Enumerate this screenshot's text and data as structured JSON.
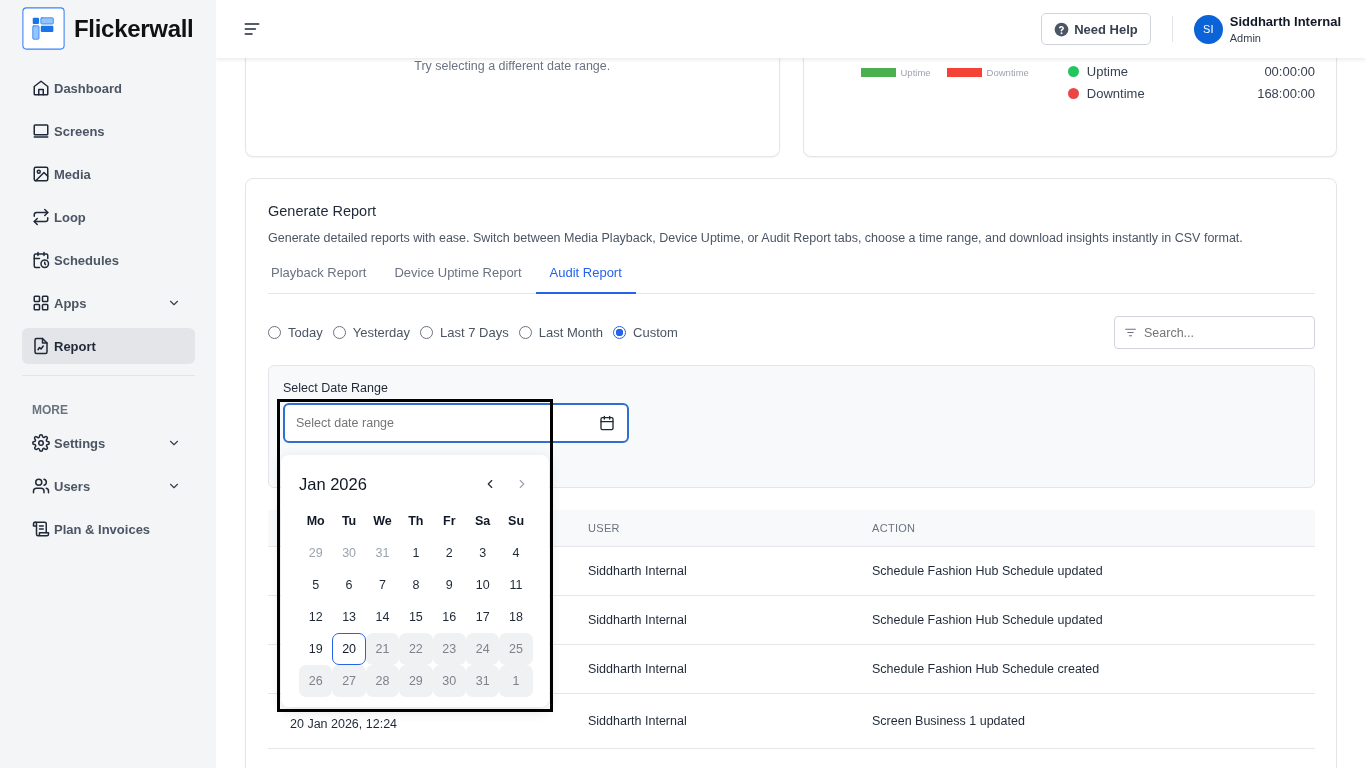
{
  "brand": {
    "name": "Flickerwall"
  },
  "sidebar": {
    "items": [
      {
        "label": "Dashboard",
        "kind": "link",
        "selected": false
      },
      {
        "label": "Screens",
        "kind": "link",
        "selected": false
      },
      {
        "label": "Media",
        "kind": "link",
        "selected": false
      },
      {
        "label": "Loop",
        "kind": "link",
        "selected": false
      },
      {
        "label": "Schedules",
        "kind": "link",
        "selected": false
      },
      {
        "label": "Apps",
        "kind": "group",
        "selected": false
      },
      {
        "label": "Report",
        "kind": "link",
        "selected": true
      }
    ],
    "section_label": "MORE",
    "more_items": [
      {
        "label": "Settings",
        "kind": "group",
        "selected": false
      },
      {
        "label": "Users",
        "kind": "group",
        "selected": false
      },
      {
        "label": "Plan & Invoices",
        "kind": "link",
        "selected": false
      }
    ]
  },
  "header": {
    "help_button": "Need Help",
    "user": {
      "initials": "SI",
      "name": "Siddharth Internal",
      "role": "Admin"
    }
  },
  "empty_card": {
    "message": "Try selecting a different date range."
  },
  "uptime_card": {
    "legend": [
      {
        "label": "Uptime",
        "color": "#4caf50"
      },
      {
        "label": "Downtime",
        "color": "#f44336"
      }
    ],
    "stats": [
      {
        "label": "Uptime",
        "value": "00:00:00",
        "color": "#22c55e"
      },
      {
        "label": "Downtime",
        "value": "168:00:00",
        "color": "#ef4444"
      }
    ]
  },
  "report": {
    "title": "Generate Report",
    "description": "Generate detailed reports with ease. Switch between Media Playback, Device Uptime, or Audit Report tabs, choose a time range, and download insights instantly in CSV format.",
    "tabs": [
      {
        "label": "Playback Report",
        "selected": false
      },
      {
        "label": "Device Uptime Report",
        "selected": false
      },
      {
        "label": "Audit Report",
        "selected": true
      }
    ],
    "ranges": [
      {
        "label": "Today",
        "selected": false
      },
      {
        "label": "Yesterday",
        "selected": false
      },
      {
        "label": "Last 7 Days",
        "selected": false
      },
      {
        "label": "Last Month",
        "selected": false
      },
      {
        "label": "Custom",
        "selected": true
      }
    ],
    "search": {
      "placeholder": "Search..."
    },
    "date_range": {
      "label": "Select Date Range",
      "placeholder": "Select date range"
    },
    "calendar": {
      "month": "Jan 2026",
      "next_disabled": true,
      "weekdays": [
        "Mo",
        "Tu",
        "We",
        "Th",
        "Fr",
        "Sa",
        "Su"
      ],
      "days": [
        {
          "label": "29",
          "outside": true,
          "disabled": false,
          "selected": false
        },
        {
          "label": "30",
          "outside": true,
          "disabled": false,
          "selected": false
        },
        {
          "label": "31",
          "outside": true,
          "disabled": false,
          "selected": false
        },
        {
          "label": "1",
          "outside": false,
          "disabled": false,
          "selected": false
        },
        {
          "label": "2",
          "outside": false,
          "disabled": false,
          "selected": false
        },
        {
          "label": "3",
          "outside": false,
          "disabled": false,
          "selected": false
        },
        {
          "label": "4",
          "outside": false,
          "disabled": false,
          "selected": false
        },
        {
          "label": "5",
          "outside": false,
          "disabled": false,
          "selected": false
        },
        {
          "label": "6",
          "outside": false,
          "disabled": false,
          "selected": false
        },
        {
          "label": "7",
          "outside": false,
          "disabled": false,
          "selected": false
        },
        {
          "label": "8",
          "outside": false,
          "disabled": false,
          "selected": false
        },
        {
          "label": "9",
          "outside": false,
          "disabled": false,
          "selected": false
        },
        {
          "label": "10",
          "outside": false,
          "disabled": false,
          "selected": false
        },
        {
          "label": "11",
          "outside": false,
          "disabled": false,
          "selected": false
        },
        {
          "label": "12",
          "outside": false,
          "disabled": false,
          "selected": false
        },
        {
          "label": "13",
          "outside": false,
          "disabled": false,
          "selected": false
        },
        {
          "label": "14",
          "outside": false,
          "disabled": false,
          "selected": false
        },
        {
          "label": "15",
          "outside": false,
          "disabled": false,
          "selected": false
        },
        {
          "label": "16",
          "outside": false,
          "disabled": false,
          "selected": false
        },
        {
          "label": "17",
          "outside": false,
          "disabled": false,
          "selected": false
        },
        {
          "label": "18",
          "outside": false,
          "disabled": false,
          "selected": false
        },
        {
          "label": "19",
          "outside": false,
          "disabled": false,
          "selected": false
        },
        {
          "label": "20",
          "outside": false,
          "disabled": false,
          "selected": true
        },
        {
          "label": "21",
          "outside": false,
          "disabled": true,
          "selected": false
        },
        {
          "label": "22",
          "outside": false,
          "disabled": true,
          "selected": false
        },
        {
          "label": "23",
          "outside": false,
          "disabled": true,
          "selected": false
        },
        {
          "label": "24",
          "outside": false,
          "disabled": true,
          "selected": false
        },
        {
          "label": "25",
          "outside": false,
          "disabled": true,
          "selected": false
        },
        {
          "label": "26",
          "outside": false,
          "disabled": true,
          "selected": false
        },
        {
          "label": "27",
          "outside": false,
          "disabled": true,
          "selected": false
        },
        {
          "label": "28",
          "outside": false,
          "disabled": true,
          "selected": false
        },
        {
          "label": "29",
          "outside": false,
          "disabled": true,
          "selected": false
        },
        {
          "label": "30",
          "outside": false,
          "disabled": true,
          "selected": false
        },
        {
          "label": "31",
          "outside": false,
          "disabled": true,
          "selected": false
        },
        {
          "label": "1",
          "outside": true,
          "disabled": true,
          "selected": false
        }
      ]
    },
    "table": {
      "columns": [
        "USER",
        "ACTION"
      ],
      "rows": [
        {
          "user": "Siddharth Internal",
          "action": "Schedule Fashion Hub Schedule updated"
        },
        {
          "user": "Siddharth Internal",
          "action": "Schedule Fashion Hub Schedule updated"
        },
        {
          "user": "Siddharth Internal",
          "action": "Schedule Fashion Hub Schedule created"
        },
        {
          "date": "20 Jan 2026, 12:24",
          "user": "Siddharth Internal",
          "action": "Screen Business 1 updated"
        }
      ]
    }
  }
}
